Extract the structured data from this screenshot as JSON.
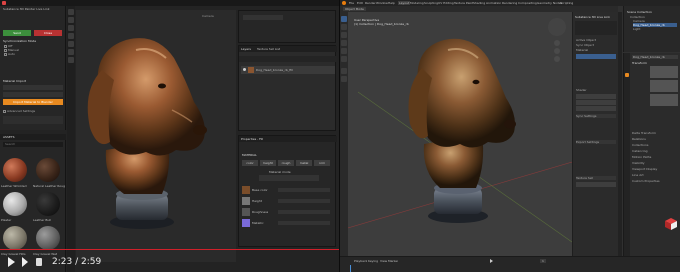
{
  "left_panel": {
    "title": "Substance 3D Painter Live Link",
    "send_label": "Send",
    "close_label": "Close",
    "section_sync_mode": "Synchronization Mode",
    "sync_options": [
      "Off",
      "Manual",
      "Auto"
    ],
    "section_import": "Material Import",
    "import_button": "Import Material to Blender",
    "section_advanced": "Advanced Settings"
  },
  "assets_panel": {
    "tab_label": "ASSETS",
    "search_placeholder": "Search",
    "materials": [
      {
        "name": "Leather Wrinkled"
      },
      {
        "name": "Natural Leather Rough"
      },
      {
        "name": "Plaster"
      },
      {
        "name": "Leather Bull"
      },
      {
        "name": "Clay Gravel Hills"
      },
      {
        "name": "Clay Gravel Wet"
      }
    ]
  },
  "viewport_left": {
    "label": "Camera",
    "video_time": "2:23 / 2:59"
  },
  "layers_panel": {
    "tab_layers": "Layers",
    "tab_texture_set": "Texture Set List",
    "layer_name": "Dog_Head_bronze_rb_fill"
  },
  "properties_panel": {
    "title": "Properties - Fill",
    "section": "MATERIAL",
    "mode_label": "Material mode",
    "channels": [
      "color",
      "height",
      "rough",
      "metal",
      "nrm"
    ],
    "channel_items": [
      {
        "name": "Base color"
      },
      {
        "name": "Height"
      },
      {
        "name": "Roughness"
      },
      {
        "name": "Metallic"
      }
    ]
  },
  "blender_topbar": {
    "menus": [
      "File",
      "Edit",
      "Render",
      "Window",
      "Help"
    ],
    "workspaces": [
      "Layout",
      "Modeling",
      "Sculpting",
      "UV Editing",
      "Texture Paint",
      "Shading",
      "Animation",
      "Rendering",
      "Compositing",
      "Geometry Nodes",
      "Scripting"
    ]
  },
  "blender_viewport": {
    "mode": "Object Mode",
    "info_line1": "User Perspective",
    "info_line2": "(1) Collection | Dog_Head_bronze_rb"
  },
  "npanel": {
    "title": "Substance 3D Live Link",
    "rows": [
      "Active Object",
      "Sync Object",
      "Material",
      "Shader",
      "Sync Settings",
      "Export Settings",
      "Texture Set"
    ]
  },
  "outliner": {
    "title": "Scene Collection",
    "items": [
      "Collection",
      "Camera",
      "Dog_Head_bronze_rb",
      "Light"
    ]
  },
  "blender_properties": {
    "object_name": "Dog_Head_bronze_rb",
    "sections": [
      "Transform",
      "Delta Transform",
      "Relations",
      "Collections",
      "Instancing",
      "Motion Paths",
      "Visibility",
      "Viewport Display",
      "Line Art",
      "Custom Properties"
    ]
  },
  "timeline": {
    "labels": [
      "Playback",
      "Keying",
      "View",
      "Marker"
    ],
    "frame": "1"
  },
  "colors": {
    "accent_orange": "#e88a20",
    "send_green": "#3c8f3c",
    "close_red": "#b83232",
    "progress_red": "#d0202a",
    "blender_selected": "#3a5f8f"
  }
}
